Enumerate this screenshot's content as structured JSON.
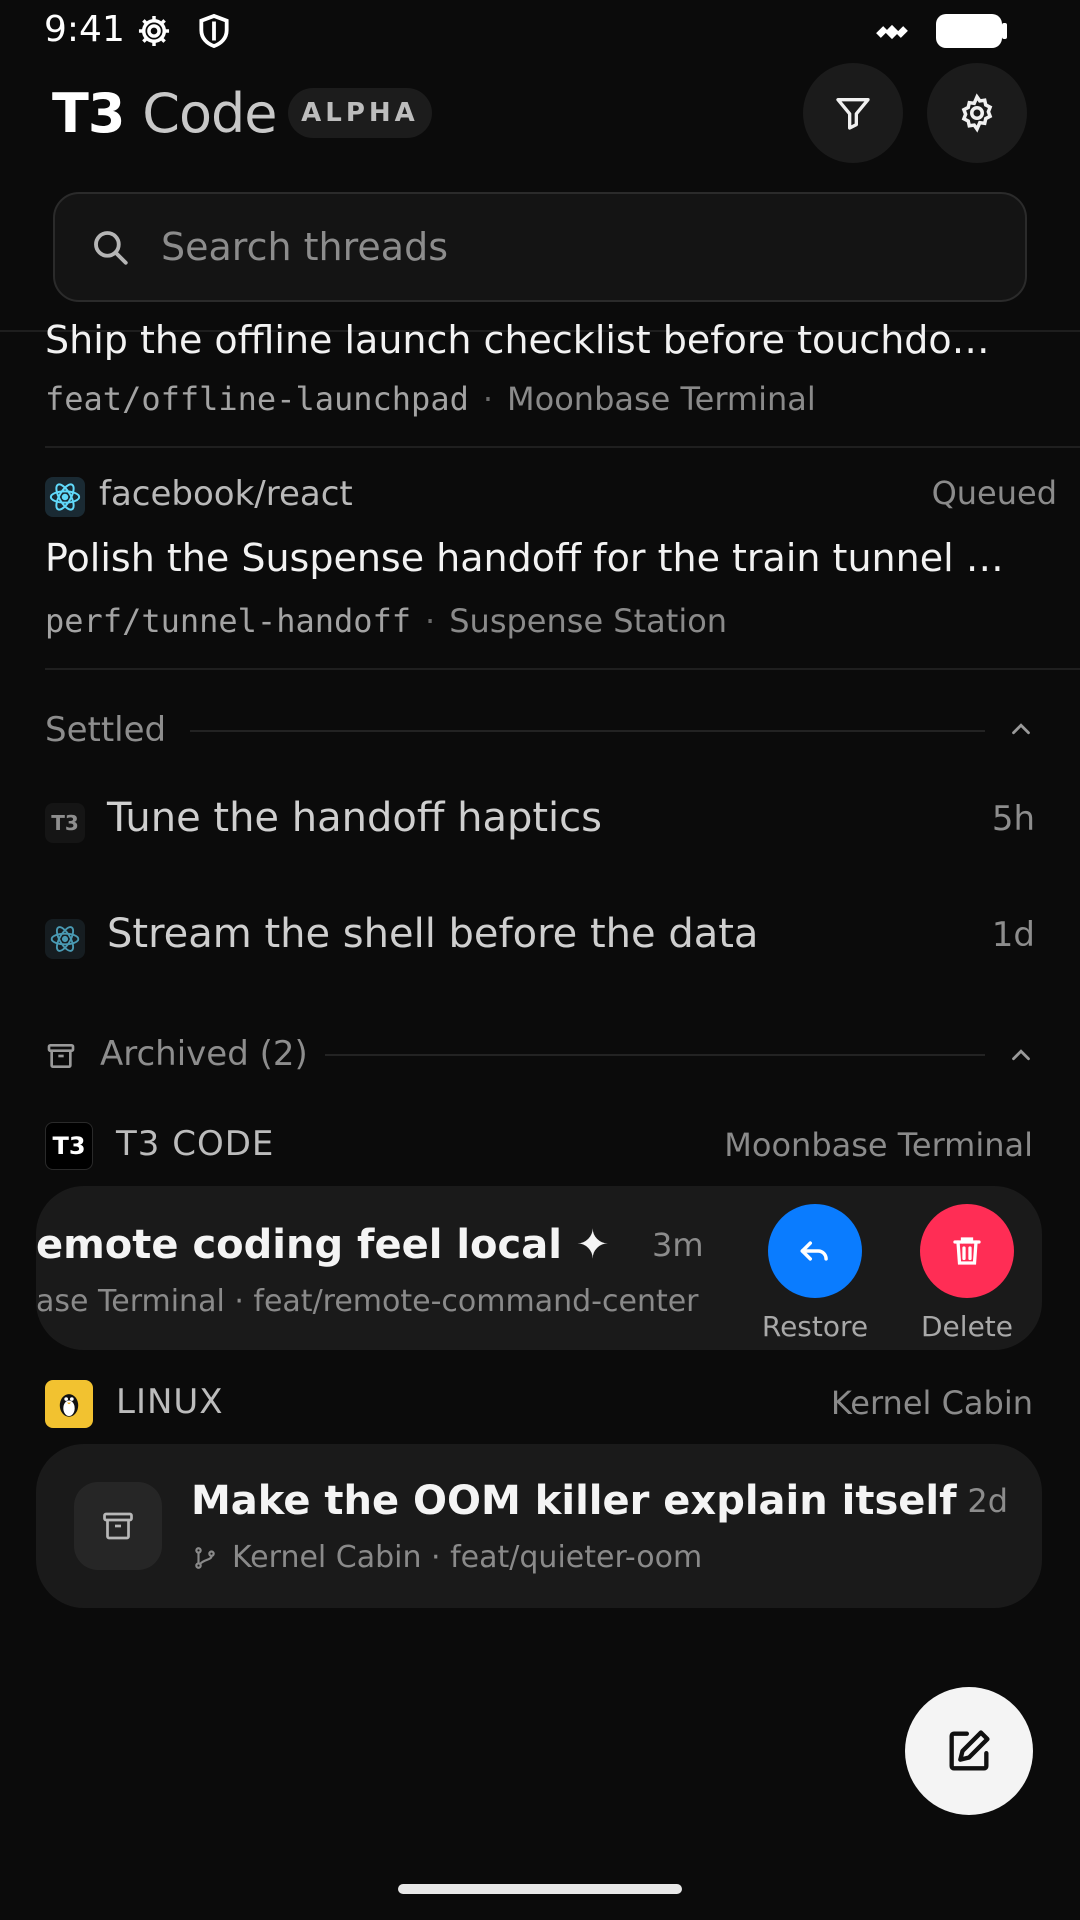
{
  "status_bar": {
    "time": "9:41"
  },
  "header": {
    "brand_bold": "T3",
    "brand_light": "Code",
    "badge": "ALPHA"
  },
  "search": {
    "placeholder": "Search threads"
  },
  "active_threads": [
    {
      "title": "Ship the offline launch checklist before touchdo…",
      "branch": "feat/offline-launchpad",
      "env": "Moonbase Terminal"
    },
    {
      "repo": "facebook/react",
      "status": "Queued",
      "title": "Polish the Suspense handoff for the train tunnel …",
      "branch": "perf/tunnel-handoff",
      "env": "Suspense Station"
    }
  ],
  "settled": {
    "label": "Settled",
    "items": [
      {
        "icon_text": "T3",
        "title": "Tune the handoff haptics",
        "time": "5h"
      },
      {
        "title": "Stream the shell before the data",
        "time": "1d"
      }
    ]
  },
  "archived": {
    "label": "Archived (2)",
    "groups": [
      {
        "icon_text": "T3",
        "name": "T3 CODE",
        "env": "Moonbase Terminal",
        "thread": {
          "title": "emote coding feel local ✦",
          "time": "3m",
          "meta": "ase Terminal · feat/remote-command-center"
        },
        "actions": {
          "restore": "Restore",
          "delete": "Delete"
        }
      },
      {
        "name": "LINUX",
        "env": "Kernel Cabin",
        "thread": {
          "title": "Make the OOM killer explain itself",
          "time": "2d",
          "meta": "Kernel Cabin · feat/quieter-oom"
        }
      }
    ]
  },
  "colors": {
    "restore": "#0a7cff",
    "delete": "#ff2d55",
    "background": "#0b0b0b"
  },
  "icons": [
    "gear-icon",
    "shield-icon",
    "satellite-icon",
    "battery-icon",
    "filter-icon",
    "settings-icon",
    "search-icon",
    "react-icon",
    "chevron-up-icon",
    "archive-icon",
    "undo-icon",
    "trash-icon",
    "tux-icon",
    "branch-icon",
    "compose-icon"
  ]
}
